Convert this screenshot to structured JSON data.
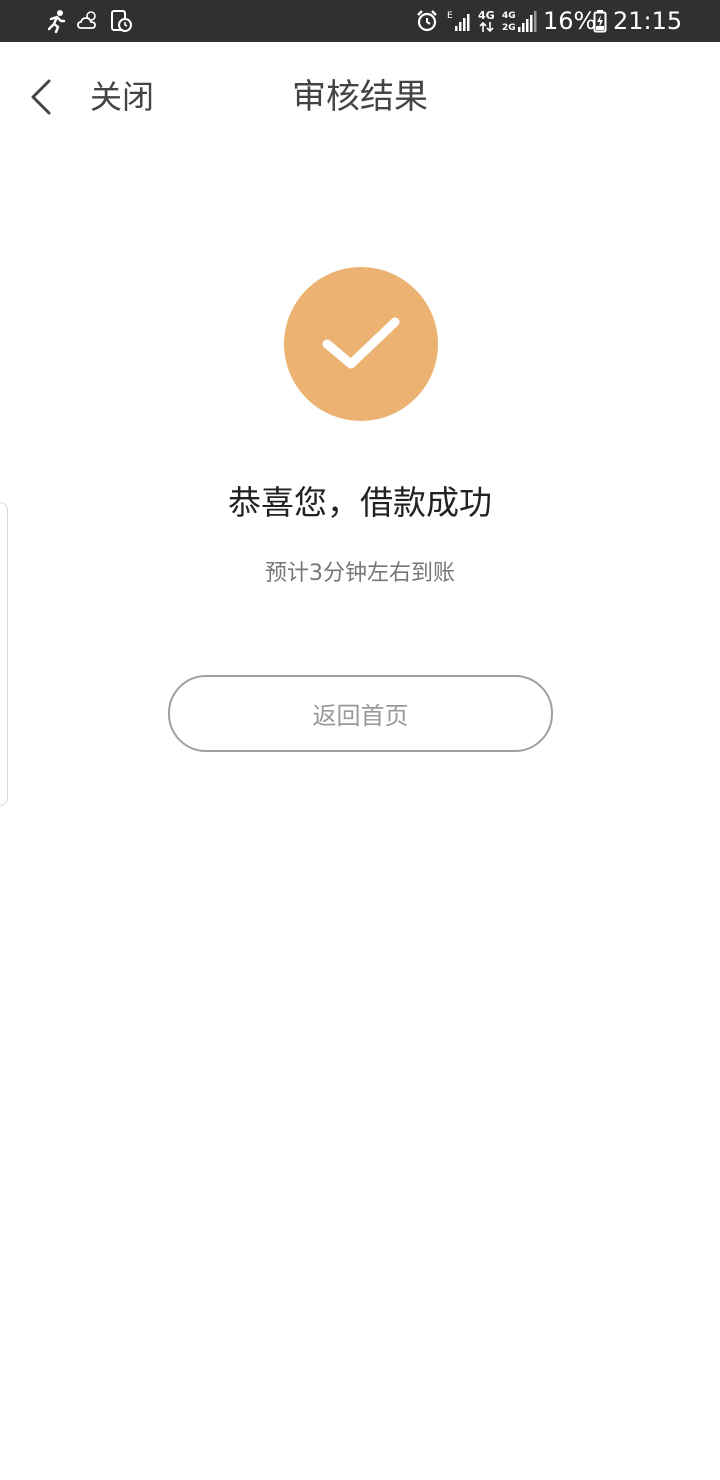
{
  "status_bar": {
    "icons_left": [
      "running-icon",
      "weather-cloud-icon",
      "clock-document-icon"
    ],
    "icons_right": [
      "alarm-icon",
      "signal-e-icon",
      "signal-4g-icon",
      "signal-4g-2g-icon",
      "battery-charging-icon"
    ],
    "net_e": "E",
    "net_4g": "4G",
    "net_4g2": "4G",
    "net_2g": "2G",
    "battery": "16%",
    "time": "21:15"
  },
  "nav": {
    "back_icon": "chevron-left-icon",
    "close_label": "关闭",
    "title": "审核结果"
  },
  "result": {
    "icon": "check-circle-icon",
    "icon_color": "#ebb271",
    "title": "恭喜您，借款成功",
    "subtitle": "预计3分钟左右到账",
    "home_button": "返回首页"
  }
}
